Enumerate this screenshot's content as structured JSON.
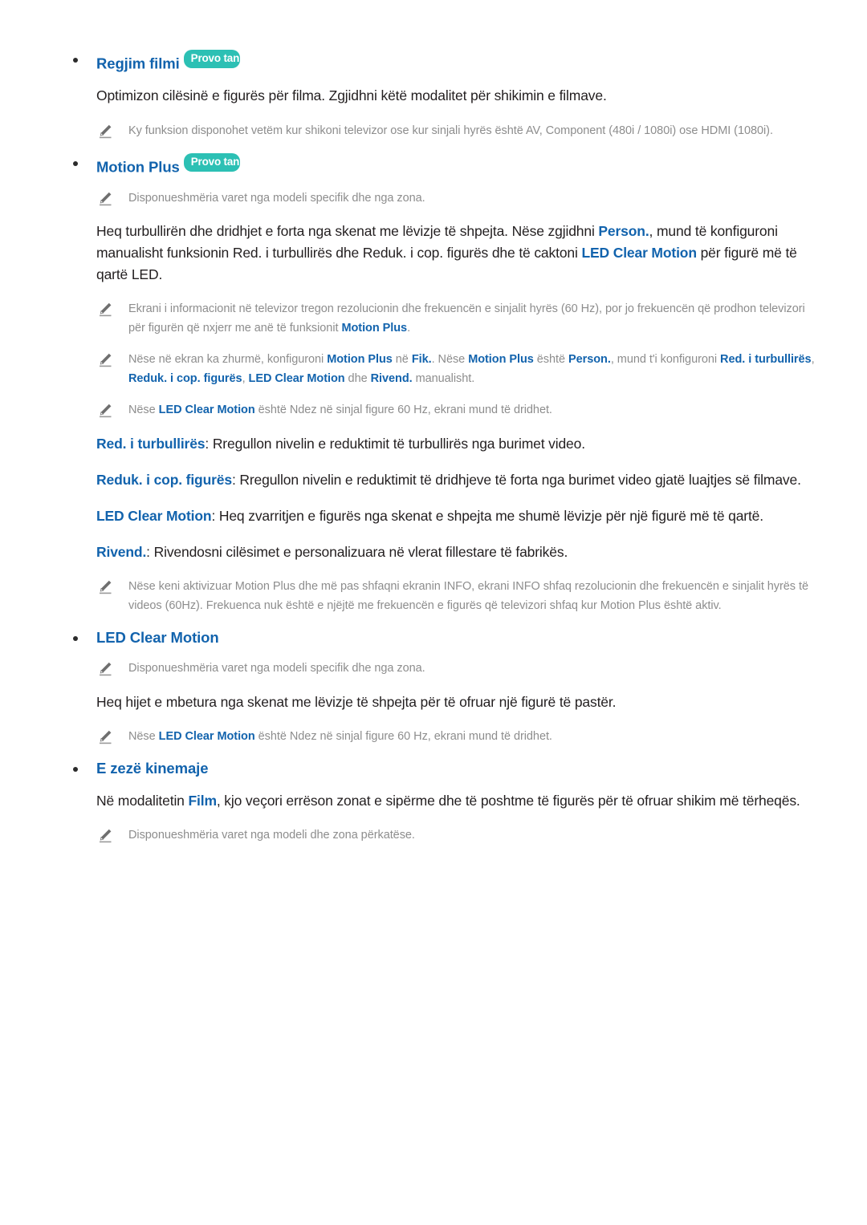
{
  "document": {
    "language": "sq",
    "accent_blue": "#1263ad",
    "badge_teal": "#2cc0b4",
    "note_gray": "#8d8d8d",
    "body_black": "#231f20"
  },
  "badges": {
    "try_now": "Provo tani"
  },
  "sections": [
    {
      "id": "regjim-filmi",
      "heading": "Regjim filmi",
      "has_try_now": true,
      "body": "Optimizon cilësinë e figurës për filma. Zgjidhni këtë modalitet për shikimin e filmave.",
      "notes": [
        "Ky funksion disponohet vetëm kur shikoni televizor ose kur sinjali hyrës është AV, Component (480i / 1080i) ose HDMI (1080i)."
      ]
    },
    {
      "id": "motion-plus",
      "heading": "Motion Plus",
      "has_try_now": true,
      "note_top": "Disponueshmëria varet nga modeli specifik dhe nga zona.",
      "body_parts": {
        "p1": "Heq turbullirën dhe dridhjet e forta nga skenat me lëvizje të shpejta. Nëse zgjidhni ",
        "b1": "Person.",
        "p2": ", mund të konfiguroni manualisht funksionin Red. i turbullirës dhe Reduk. i cop. figurës dhe të caktoni ",
        "b2": "LED Clear Motion",
        "p3": " për figurë më të qartë LED."
      },
      "notes_rich": [
        {
          "parts": [
            {
              "t": "Ekrani i informacionit në televizor tregon rezolucionin dhe frekuencën e sinjalit hyrës (60 Hz), por jo frekuencën që prodhon televizori për figurën që nxjerr me anë të funksionit ",
              "b": false
            },
            {
              "t": "Motion Plus",
              "b": true
            },
            {
              "t": ".",
              "b": false
            }
          ]
        },
        {
          "parts": [
            {
              "t": "Nëse në ekran ka zhurmë, konfiguroni ",
              "b": false
            },
            {
              "t": "Motion Plus",
              "b": true
            },
            {
              "t": " në ",
              "b": false
            },
            {
              "t": "Fik.",
              "b": true
            },
            {
              "t": ". Nëse ",
              "b": false
            },
            {
              "t": "Motion Plus",
              "b": true
            },
            {
              "t": " është ",
              "b": false
            },
            {
              "t": "Person.",
              "b": true
            },
            {
              "t": ", mund t'i konfiguroni ",
              "b": false
            },
            {
              "t": "Red. i turbullirës",
              "b": true
            },
            {
              "t": ", ",
              "b": false
            },
            {
              "t": "Reduk. i cop. figurës",
              "b": true
            },
            {
              "t": ", ",
              "b": false
            },
            {
              "t": "LED Clear Motion",
              "b": true
            },
            {
              "t": " dhe ",
              "b": false
            },
            {
              "t": "Rivend.",
              "b": true
            },
            {
              "t": " manualisht.",
              "b": false
            }
          ]
        },
        {
          "parts": [
            {
              "t": "Nëse ",
              "b": false
            },
            {
              "t": "LED Clear Motion",
              "b": true
            },
            {
              "t": " është Ndez  në sinjal figure 60 Hz, ekrani mund të dridhet.",
              "b": false
            }
          ]
        }
      ],
      "definitions": [
        {
          "term": "Red. i turbullirës",
          "desc": ": Rregullon nivelin e reduktimit të turbullirës nga burimet video."
        },
        {
          "term": "Reduk. i cop. figurës",
          "desc": ": Rregullon nivelin e reduktimit të dridhjeve të forta nga burimet video gjatë luajtjes së filmave."
        },
        {
          "term": "LED Clear Motion",
          "desc": ": Heq zvarritjen e figurës nga skenat e shpejta me shumë lëvizje për një figurë më të qartë."
        },
        {
          "term": "Rivend.",
          "desc": ": Rivendosni cilësimet e personalizuara në vlerat fillestare të fabrikës."
        }
      ],
      "note_bottom": "Nëse keni aktivizuar Motion Plus dhe më pas shfaqni ekranin INFO, ekrani INFO shfaq rezolucionin dhe frekuencën e sinjalit hyrës të videos (60Hz). Frekuenca nuk është e njëjtë me frekuencën e figurës që televizori shfaq kur Motion Plus është aktiv."
    },
    {
      "id": "led-clear-motion",
      "heading": "LED Clear Motion",
      "has_try_now": false,
      "note_top": "Disponueshmëria varet nga modeli specifik dhe nga zona.",
      "body": "Heq hijet e mbetura nga skenat me lëvizje të shpejta për të ofruar një figurë të pastër.",
      "note_rich": {
        "parts": [
          {
            "t": "Nëse ",
            "b": false
          },
          {
            "t": "LED Clear Motion",
            "b": true
          },
          {
            "t": " është Ndez  në sinjal figure 60 Hz, ekrani mund të dridhet.",
            "b": false
          }
        ]
      }
    },
    {
      "id": "e-zeze-kinemaje",
      "heading": "E zezë kinemaje",
      "has_try_now": false,
      "body_parts": {
        "p1": "Në modalitetin ",
        "b1": "Film",
        "p2": ", kjo veçori errëson zonat e sipërme dhe të poshtme të figurës për të ofruar shikim më tërheqës."
      },
      "note": "Disponueshmëria varet nga modeli dhe zona përkatëse."
    }
  ],
  "icons": {
    "pencil": "pencil-icon",
    "bullet": "bullet-dot"
  }
}
